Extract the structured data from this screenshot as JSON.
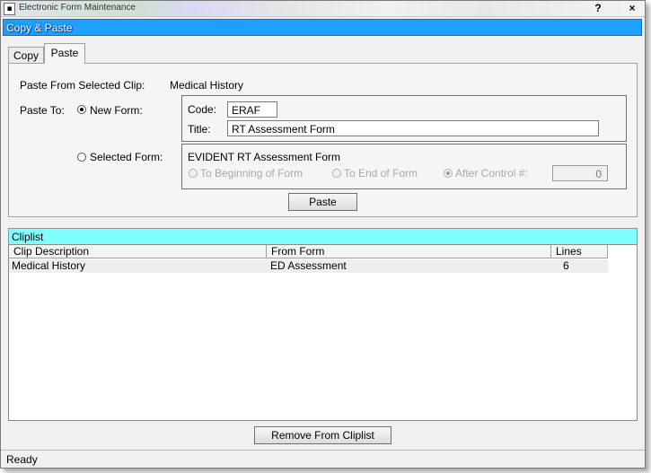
{
  "window": {
    "title": "Electronic Form Maintenance",
    "app_icon": "window-icon",
    "help_glyph": "?",
    "close_glyph": "×"
  },
  "banner": {
    "title": "Copy & Paste"
  },
  "tabs": [
    {
      "label": "Copy",
      "active": false
    },
    {
      "label": "Paste",
      "active": true
    }
  ],
  "paste": {
    "from_label": "Paste From Selected Clip:",
    "from_value": "Medical History",
    "to_label": "Paste To:",
    "new_form_label": "New Form:",
    "new_form_selected": true,
    "code_label": "Code:",
    "code_value": "ERAF",
    "title_label": "Title:",
    "title_value": "RT Assessment Form",
    "selected_form_label": "Selected Form:",
    "selected_form_name": "EVIDENT RT Assessment Form",
    "options": [
      {
        "label": "To Beginning of Form",
        "selected": false
      },
      {
        "label": "To End of Form",
        "selected": false
      },
      {
        "label": "After Control #:",
        "selected": true
      }
    ],
    "control_number": "0",
    "paste_button": "Paste"
  },
  "cliplist": {
    "title": "Cliplist",
    "columns": [
      "Clip Description",
      "From Form",
      "Lines"
    ],
    "rows": [
      {
        "description": "Medical History",
        "from_form": "ED Assessment",
        "lines": "6"
      }
    ],
    "remove_button": "Remove From Cliplist"
  },
  "status": {
    "text": "Ready"
  },
  "colors": {
    "banner": "#1f9fff",
    "cliplist_header": "#80ffff"
  }
}
